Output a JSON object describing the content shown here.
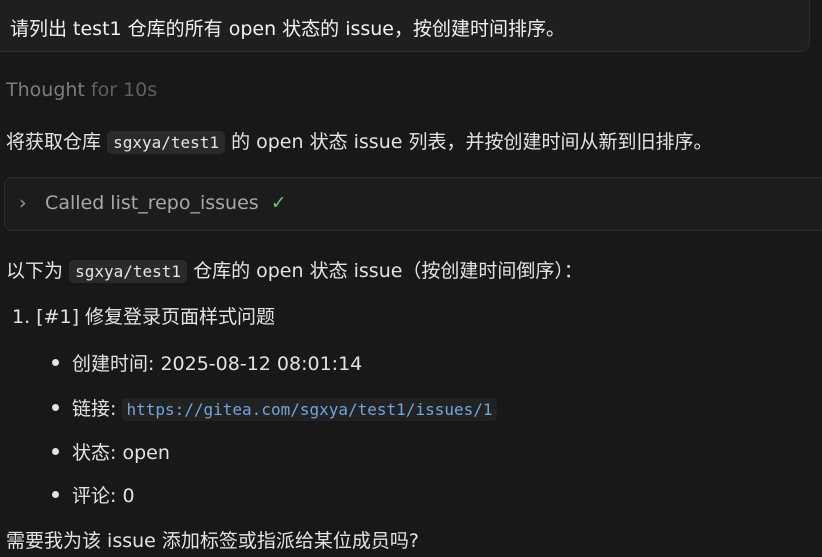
{
  "user_message": "请列出 test1 仓库的所有 open 状态的 issue，按创建时间排序。",
  "thought": {
    "label": "Thought",
    "duration": "for 10s"
  },
  "intro": {
    "before": "将获取仓库",
    "repo": "sgxya/test1",
    "after": "的 open 状态 issue 列表，并按创建时间从新到旧排序。"
  },
  "tool_call": {
    "chevron": "chevron-right-icon",
    "label": "Called list_repo_issues",
    "status_icon": "check-icon",
    "status_color": "#6fbf73"
  },
  "summary": {
    "before": "以下为",
    "repo": "sgxya/test1",
    "after": "仓库的 open 状态 issue（按创建时间倒序）："
  },
  "issues": [
    {
      "index": "1.",
      "title": "[#1] 修复登录页面样式问题",
      "created_label": "创建时间:",
      "created_value": "2025-08-12 08:01:14",
      "link_label": "链接:",
      "link_value": "https://gitea.com/sgxya/test1/issues/1",
      "status_label": "状态:",
      "status_value": "open",
      "comments_label": "评论:",
      "comments_value": "0"
    }
  ],
  "follow_up": "需要我为该 issue 添加标签或指派给某位成员吗?"
}
